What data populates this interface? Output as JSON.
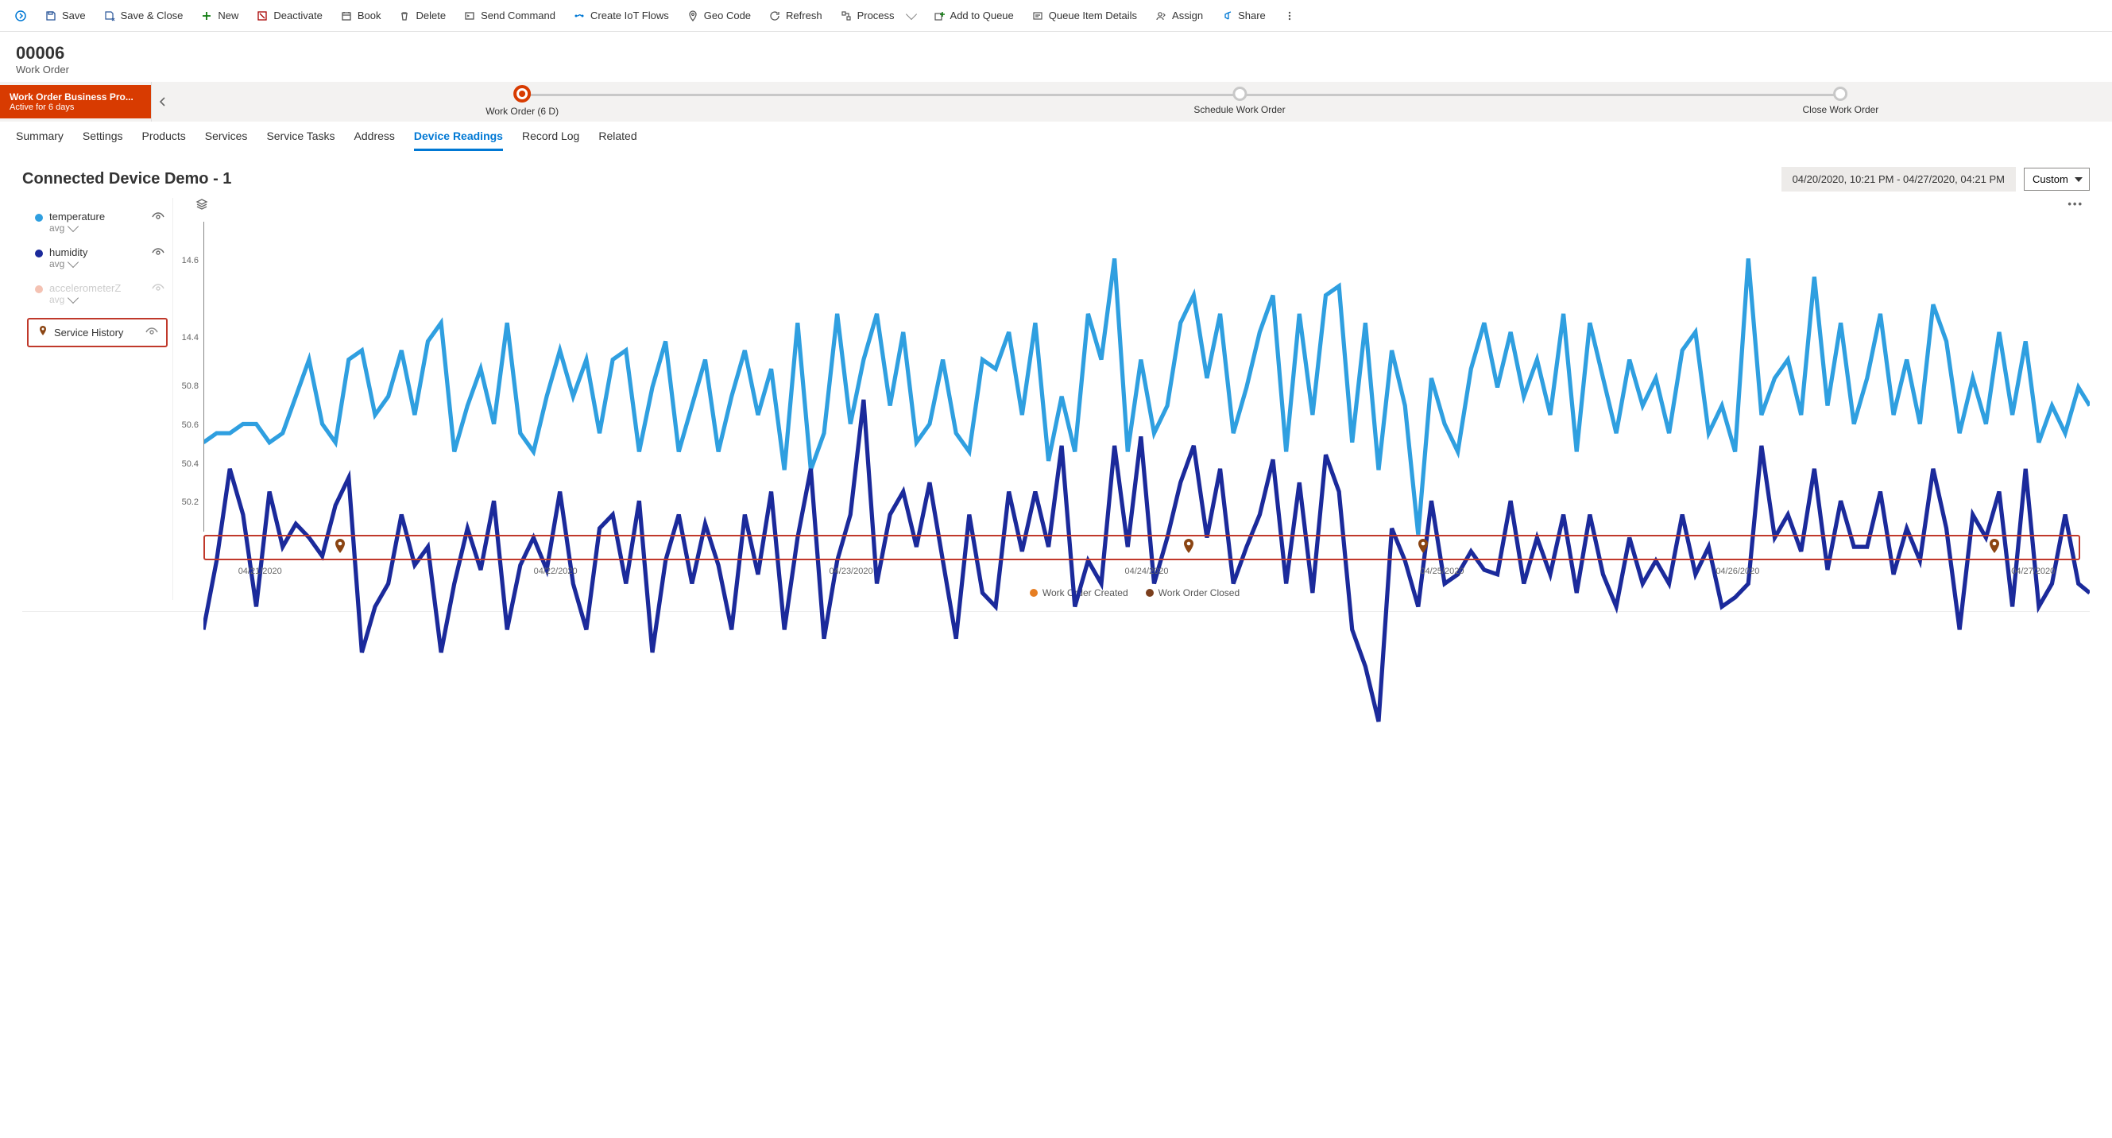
{
  "toolbar": {
    "save": "Save",
    "save_close": "Save & Close",
    "new": "New",
    "deactivate": "Deactivate",
    "book": "Book",
    "delete": "Delete",
    "send_command": "Send Command",
    "create_iot_flows": "Create IoT Flows",
    "geo_code": "Geo Code",
    "refresh": "Refresh",
    "process": "Process",
    "add_to_queue": "Add to Queue",
    "queue_item_details": "Queue Item Details",
    "assign": "Assign",
    "share": "Share"
  },
  "header": {
    "id": "00006",
    "entity": "Work Order"
  },
  "bpf": {
    "name": "Work Order Business Pro...",
    "duration": "Active for 6 days",
    "stages": [
      {
        "label": "Work Order",
        "duration": " (6 D)",
        "active": true
      },
      {
        "label": "Schedule Work Order",
        "active": false
      },
      {
        "label": "Close Work Order",
        "active": false
      }
    ]
  },
  "tabs": [
    "Summary",
    "Settings",
    "Products",
    "Services",
    "Service Tasks",
    "Address",
    "Device Readings",
    "Record Log",
    "Related"
  ],
  "active_tab": "Device Readings",
  "panel": {
    "title": "Connected Device Demo - 1",
    "range_text": "04/20/2020, 10:21 PM - 04/27/2020, 04:21 PM",
    "range_preset": "Custom"
  },
  "legend": {
    "series": [
      {
        "name": "temperature",
        "agg": "avg",
        "color": "#2f9fe0",
        "enabled": true
      },
      {
        "name": "humidity",
        "agg": "avg",
        "color": "#1b2a9b",
        "enabled": true
      },
      {
        "name": "accelerometerZ",
        "agg": "avg",
        "color": "#f4c2b3",
        "enabled": false
      }
    ],
    "service_history": "Service History"
  },
  "footer_legend": {
    "created": {
      "label": "Work Order Created",
      "color": "#e67e22"
    },
    "closed": {
      "label": "Work Order Closed",
      "color": "#7b3f1d"
    }
  },
  "x_ticks": [
    "04/21/2020",
    "04/22/2020",
    "04/23/2020",
    "04/24/2020",
    "04/25/2020",
    "04/26/2020",
    "04/27/2020"
  ],
  "service_events_pct": [
    7.2,
    52.5,
    65.0,
    95.5
  ],
  "chart_data": [
    {
      "type": "line",
      "name": "temperature",
      "color": "#2f9fe0",
      "ylabel": "",
      "ylim": [
        14.3,
        14.7
      ],
      "xlim": [
        "04/20/2020 22:21",
        "04/27/2020 16:21"
      ],
      "y_ticks": [
        14.4,
        14.6
      ],
      "x": [
        0,
        0.7,
        1.4,
        2.1,
        2.8,
        3.5,
        4.2,
        4.9,
        5.6,
        6.3,
        7.0,
        7.7,
        8.4,
        9.1,
        9.8,
        10.5,
        11.2,
        11.9,
        12.6,
        13.3,
        14.0,
        14.7,
        15.4,
        16.1,
        16.8,
        17.5,
        18.2,
        18.9,
        19.6,
        20.3,
        21.0,
        21.7,
        22.4,
        23.1,
        23.8,
        24.5,
        25.2,
        25.9,
        26.6,
        27.3,
        28.0,
        28.7,
        29.4,
        30.1,
        30.8,
        31.5,
        32.2,
        32.9,
        33.6,
        34.3,
        35.0,
        35.7,
        36.4,
        37.1,
        37.8,
        38.5,
        39.2,
        39.9,
        40.6,
        41.3,
        42.0,
        42.7,
        43.4,
        44.1,
        44.8,
        45.5,
        46.2,
        46.9,
        47.6,
        48.3,
        49.0,
        49.7,
        50.4,
        51.1,
        51.8,
        52.5,
        53.2,
        53.9,
        54.6,
        55.3,
        56.0,
        56.7,
        57.4,
        58.1,
        58.8,
        59.5,
        60.2,
        60.9,
        61.6,
        62.3,
        63.0,
        63.7,
        64.4,
        65.1,
        65.8,
        66.5,
        67.2,
        67.9,
        68.6,
        69.3,
        70.0,
        70.7,
        71.4,
        72.1,
        72.8,
        73.5,
        74.2,
        74.9,
        75.6,
        76.3,
        77.0,
        77.7,
        78.4,
        79.1,
        79.8,
        80.5,
        81.2,
        81.9,
        82.6,
        83.3,
        84.0,
        84.7,
        85.4,
        86.1,
        86.8,
        87.5,
        88.2,
        88.9,
        89.6,
        90.3,
        91.0,
        91.7,
        92.4,
        93.1,
        93.8,
        94.5,
        95.2,
        95.9,
        96.6,
        97.3,
        98.0,
        98.7,
        99.4,
        100.0
      ],
      "values": [
        14.46,
        14.47,
        14.47,
        14.48,
        14.48,
        14.46,
        14.47,
        14.51,
        14.55,
        14.48,
        14.46,
        14.55,
        14.56,
        14.49,
        14.51,
        14.56,
        14.49,
        14.57,
        14.59,
        14.45,
        14.5,
        14.54,
        14.48,
        14.59,
        14.47,
        14.45,
        14.51,
        14.56,
        14.51,
        14.55,
        14.47,
        14.55,
        14.56,
        14.45,
        14.52,
        14.57,
        14.45,
        14.5,
        14.55,
        14.45,
        14.51,
        14.56,
        14.49,
        14.54,
        14.43,
        14.59,
        14.43,
        14.47,
        14.6,
        14.48,
        14.55,
        14.6,
        14.5,
        14.58,
        14.46,
        14.48,
        14.55,
        14.47,
        14.45,
        14.55,
        14.54,
        14.58,
        14.49,
        14.59,
        14.44,
        14.51,
        14.45,
        14.6,
        14.55,
        14.66,
        14.45,
        14.55,
        14.47,
        14.5,
        14.59,
        14.62,
        14.53,
        14.6,
        14.47,
        14.52,
        14.58,
        14.62,
        14.45,
        14.6,
        14.49,
        14.62,
        14.63,
        14.46,
        14.59,
        14.43,
        14.56,
        14.5,
        14.36,
        14.53,
        14.48,
        14.45,
        14.54,
        14.59,
        14.52,
        14.58,
        14.51,
        14.55,
        14.49,
        14.6,
        14.45,
        14.59,
        14.53,
        14.47,
        14.55,
        14.5,
        14.53,
        14.47,
        14.56,
        14.58,
        14.47,
        14.5,
        14.45,
        14.66,
        14.49,
        14.53,
        14.55,
        14.49,
        14.64,
        14.5,
        14.59,
        14.48,
        14.53,
        14.6,
        14.49,
        14.55,
        14.48,
        14.61,
        14.57,
        14.47,
        14.53,
        14.48,
        14.58,
        14.49,
        14.57,
        14.46,
        14.5,
        14.47,
        14.52,
        14.5
      ]
    },
    {
      "type": "line",
      "name": "humidity",
      "color": "#1b2a9b",
      "ylabel": "",
      "ylim": [
        50.05,
        50.85
      ],
      "xlim": [
        "04/20/2020 22:21",
        "04/27/2020 16:21"
      ],
      "y_ticks": [
        50.2,
        50.4,
        50.6,
        50.8
      ],
      "x": [
        0,
        0.7,
        1.4,
        2.1,
        2.8,
        3.5,
        4.2,
        4.9,
        5.6,
        6.3,
        7.0,
        7.7,
        8.4,
        9.1,
        9.8,
        10.5,
        11.2,
        11.9,
        12.6,
        13.3,
        14.0,
        14.7,
        15.4,
        16.1,
        16.8,
        17.5,
        18.2,
        18.9,
        19.6,
        20.3,
        21.0,
        21.7,
        22.4,
        23.1,
        23.8,
        24.5,
        25.2,
        25.9,
        26.6,
        27.3,
        28.0,
        28.7,
        29.4,
        30.1,
        30.8,
        31.5,
        32.2,
        32.9,
        33.6,
        34.3,
        35.0,
        35.7,
        36.4,
        37.1,
        37.8,
        38.5,
        39.2,
        39.9,
        40.6,
        41.3,
        42.0,
        42.7,
        43.4,
        44.1,
        44.8,
        45.5,
        46.2,
        46.9,
        47.6,
        48.3,
        49.0,
        49.7,
        50.4,
        51.1,
        51.8,
        52.5,
        53.2,
        53.9,
        54.6,
        55.3,
        56.0,
        56.7,
        57.4,
        58.1,
        58.8,
        59.5,
        60.2,
        60.9,
        61.6,
        62.3,
        63.0,
        63.7,
        64.4,
        65.1,
        65.8,
        66.5,
        67.2,
        67.9,
        68.6,
        69.3,
        70.0,
        70.7,
        71.4,
        72.1,
        72.8,
        73.5,
        74.2,
        74.9,
        75.6,
        76.3,
        77.0,
        77.7,
        78.4,
        79.1,
        79.8,
        80.5,
        81.2,
        81.9,
        82.6,
        83.3,
        84.0,
        84.7,
        85.4,
        86.1,
        86.8,
        87.5,
        88.2,
        88.9,
        89.6,
        90.3,
        91.0,
        91.7,
        92.4,
        93.1,
        93.8,
        94.5,
        95.2,
        95.9,
        96.6,
        97.3,
        98.0,
        98.7,
        99.4,
        100.0
      ],
      "values": [
        50.3,
        50.45,
        50.65,
        50.55,
        50.35,
        50.6,
        50.48,
        50.53,
        50.5,
        50.46,
        50.57,
        50.63,
        50.25,
        50.35,
        50.4,
        50.55,
        50.44,
        50.48,
        50.25,
        50.4,
        50.52,
        50.43,
        50.58,
        50.3,
        50.44,
        50.5,
        50.43,
        50.6,
        50.4,
        50.3,
        50.52,
        50.55,
        50.4,
        50.58,
        50.25,
        50.45,
        50.55,
        50.4,
        50.53,
        50.44,
        50.3,
        50.55,
        50.42,
        50.6,
        50.3,
        50.5,
        50.65,
        50.28,
        50.45,
        50.55,
        50.8,
        50.4,
        50.55,
        50.6,
        50.48,
        50.62,
        50.45,
        50.28,
        50.55,
        50.38,
        50.35,
        50.6,
        50.47,
        50.6,
        50.48,
        50.7,
        50.35,
        50.45,
        50.4,
        50.7,
        50.48,
        50.72,
        50.4,
        50.5,
        50.62,
        50.7,
        50.5,
        50.65,
        50.4,
        50.48,
        50.55,
        50.67,
        50.4,
        50.62,
        50.38,
        50.68,
        50.6,
        50.3,
        50.22,
        50.1,
        50.52,
        50.45,
        50.35,
        50.58,
        50.4,
        50.42,
        50.47,
        50.43,
        50.42,
        50.58,
        50.4,
        50.5,
        50.42,
        50.55,
        50.38,
        50.55,
        50.42,
        50.35,
        50.5,
        50.4,
        50.45,
        50.4,
        50.55,
        50.42,
        50.48,
        50.35,
        50.37,
        50.4,
        50.7,
        50.5,
        50.55,
        50.47,
        50.65,
        50.43,
        50.58,
        50.48,
        50.48,
        50.6,
        50.42,
        50.52,
        50.45,
        50.65,
        50.52,
        50.3,
        50.55,
        50.5,
        50.6,
        50.35,
        50.65,
        50.35,
        50.4,
        50.55,
        50.4,
        50.38
      ]
    }
  ]
}
